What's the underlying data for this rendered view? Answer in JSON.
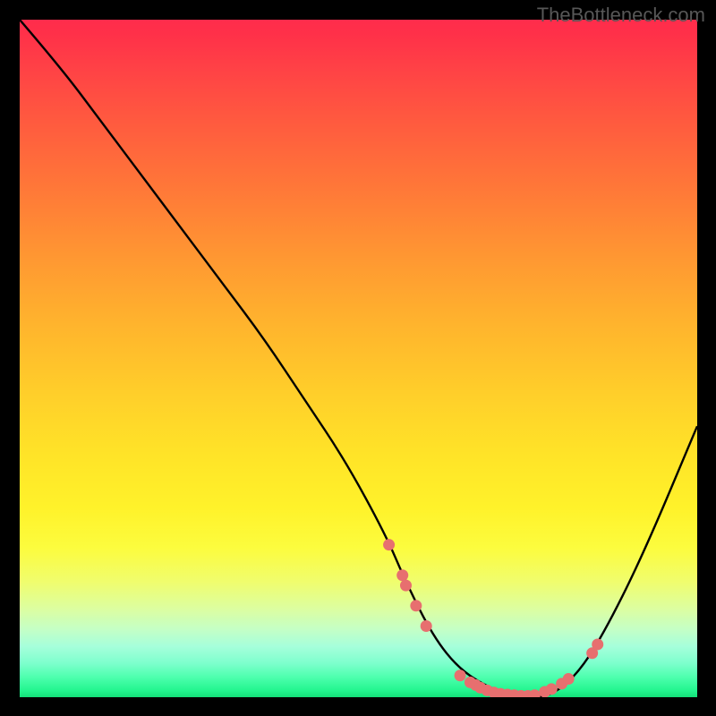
{
  "watermark": "TheBottleneck.com",
  "chart_data": {
    "type": "line",
    "title": "",
    "xlabel": "",
    "ylabel": "",
    "xlim": [
      0,
      100
    ],
    "ylim": [
      0,
      100
    ],
    "series": [
      {
        "name": "curve",
        "x": [
          0,
          6,
          12,
          18,
          24,
          30,
          36,
          42,
          48,
          54,
          57,
          61,
          65,
          70,
          74,
          78,
          82,
          86,
          92,
          100
        ],
        "y": [
          100,
          93,
          85,
          77,
          69,
          61,
          53,
          44,
          35,
          24,
          17,
          9,
          4,
          1,
          0,
          0,
          3,
          9,
          21,
          40
        ]
      }
    ],
    "markers": [
      {
        "x": 54.5,
        "y": 22.5
      },
      {
        "x": 56.5,
        "y": 18.0
      },
      {
        "x": 57.0,
        "y": 16.5
      },
      {
        "x": 58.5,
        "y": 13.5
      },
      {
        "x": 60.0,
        "y": 10.5
      },
      {
        "x": 65.0,
        "y": 3.2
      },
      {
        "x": 66.5,
        "y": 2.2
      },
      {
        "x": 67.3,
        "y": 1.8
      },
      {
        "x": 68.0,
        "y": 1.4
      },
      {
        "x": 69.0,
        "y": 1.0
      },
      {
        "x": 70.0,
        "y": 0.7
      },
      {
        "x": 71.0,
        "y": 0.5
      },
      {
        "x": 72.0,
        "y": 0.4
      },
      {
        "x": 73.0,
        "y": 0.3
      },
      {
        "x": 74.0,
        "y": 0.2
      },
      {
        "x": 75.0,
        "y": 0.2
      },
      {
        "x": 76.0,
        "y": 0.3
      },
      {
        "x": 77.5,
        "y": 0.8
      },
      {
        "x": 78.5,
        "y": 1.2
      },
      {
        "x": 80.0,
        "y": 2.0
      },
      {
        "x": 81.0,
        "y": 2.7
      },
      {
        "x": 84.5,
        "y": 6.5
      },
      {
        "x": 85.3,
        "y": 7.8
      }
    ],
    "colors": {
      "curve": "#000000",
      "markers": "#e76f6f",
      "gradient_top": "#ff2c4c",
      "gradient_mid": "#ffe328",
      "gradient_bottom": "#14e079"
    }
  }
}
